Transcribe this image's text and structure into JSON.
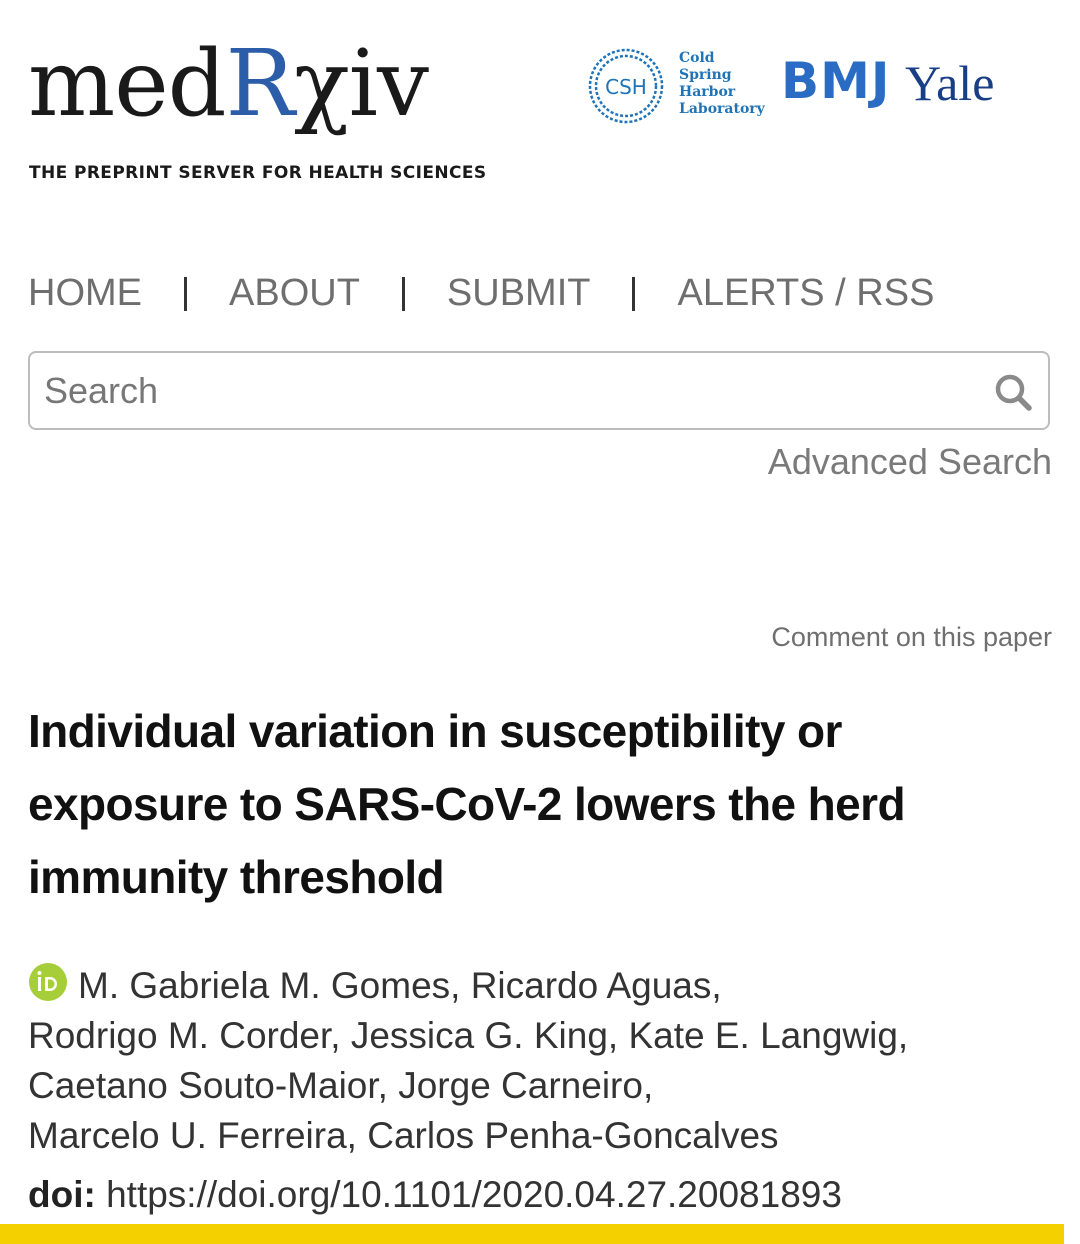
{
  "header": {
    "logo_prefix": "med",
    "logo_r": "R",
    "logo_suffix": "χiv",
    "tagline": "THE PREPRINT SERVER FOR HEALTH SCIENCES",
    "partners": {
      "csh_badge": "CSH",
      "csh_lines": [
        "Cold",
        "Spring",
        "Harbor",
        "Laboratory"
      ],
      "bmj": "BMJ",
      "yale": "Yale"
    }
  },
  "nav": {
    "items": [
      "HOME",
      "ABOUT",
      "SUBMIT",
      "ALERTS / RSS"
    ]
  },
  "search": {
    "placeholder": "Search",
    "advanced_label": "Advanced Search"
  },
  "article": {
    "comment_link": "Comment on this paper",
    "title": "Individual variation in susceptibility or exposure to SARS-CoV-2 lowers the herd immunity threshold",
    "authors_lines": [
      "M. Gabriela M. Gomes, Ricardo Aguas,",
      "Rodrigo M. Corder, Jessica G. King, Kate E. Langwig,",
      "Caetano Souto-Maior, Jorge Carneiro,",
      "Marcelo U. Ferreira, Carlos Penha-Goncalves"
    ],
    "doi_label": "doi:",
    "doi_value": "https://doi.org/10.1101/2020.04.27.20081893"
  },
  "colors": {
    "brand_blue": "#2c5da8",
    "csh_blue": "#1f73b7",
    "bmj_blue": "#2a6cc3",
    "yale_blue": "#183e85",
    "orcid_green": "#a6ce39",
    "highlight_yellow": "#f5d000"
  },
  "icons": [
    "search-icon",
    "orcid-icon",
    "csh-dna-ring-icon"
  ]
}
